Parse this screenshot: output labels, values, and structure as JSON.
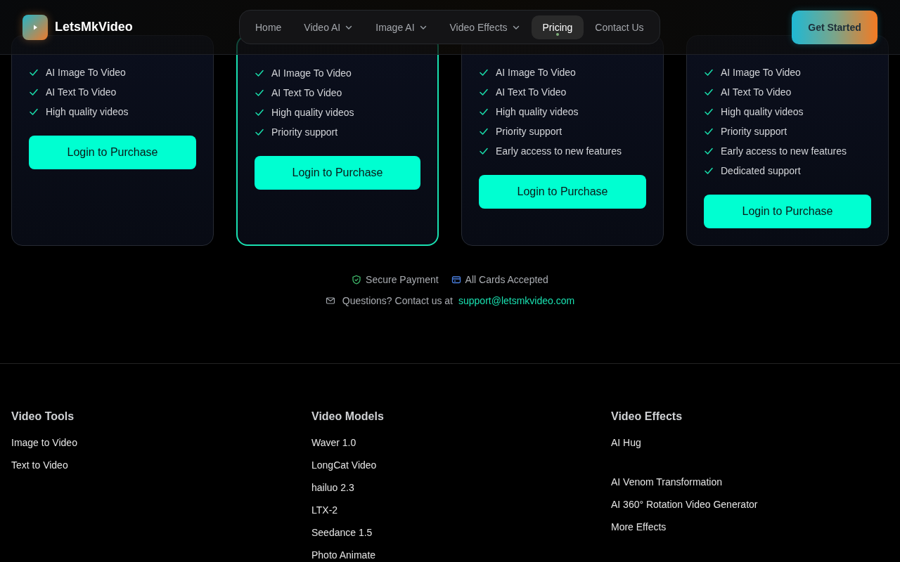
{
  "brand": {
    "name": "LetsMkVideo"
  },
  "nav": [
    {
      "label": "Home",
      "dropdown": false,
      "selected": false
    },
    {
      "label": "Video AI",
      "dropdown": true,
      "selected": false
    },
    {
      "label": "Image AI",
      "dropdown": true,
      "selected": false
    },
    {
      "label": "Video Effects",
      "dropdown": true,
      "selected": false
    },
    {
      "label": "Pricing",
      "dropdown": false,
      "selected": true
    },
    {
      "label": "Contact Us",
      "dropdown": false,
      "selected": false
    }
  ],
  "cta": "Get Started",
  "plans": [
    {
      "highlighted": false,
      "features": [
        "AI Image To Video",
        "AI Text To Video",
        "High quality videos"
      ],
      "button": "Login to Purchase"
    },
    {
      "highlighted": true,
      "features": [
        "AI Image To Video",
        "AI Text To Video",
        "High quality videos",
        "Priority support"
      ],
      "button": "Login to Purchase"
    },
    {
      "highlighted": false,
      "features": [
        "AI Image To Video",
        "AI Text To Video",
        "High quality videos",
        "Priority support",
        "Early access to new features"
      ],
      "button": "Login to Purchase"
    },
    {
      "highlighted": false,
      "features": [
        "AI Image To Video",
        "AI Text To Video",
        "High quality videos",
        "Priority support",
        "Early access to new features",
        "Dedicated support"
      ],
      "button": "Login to Purchase"
    }
  ],
  "trust": [
    {
      "kind": "shield",
      "label": "Secure Payment"
    },
    {
      "kind": "card",
      "label": "All Cards Accepted"
    }
  ],
  "contact": {
    "text": "Questions? Contact us at",
    "email": "support@letsmkvideo.com"
  },
  "footer": [
    {
      "title": "Video Tools",
      "links": [
        "Image to Video",
        "Text to Video"
      ]
    },
    {
      "title": "Video Models",
      "links": [
        "Waver 1.0",
        "LongCat Video",
        "hailuo 2.3",
        "LTX-2",
        "Seedance 1.5",
        "Photo Animate"
      ]
    },
    {
      "title": "Video Effects",
      "links": [
        "AI Hug",
        "AI Venom Transformation",
        "AI 360° Rotation Video Generator",
        "More Effects"
      ]
    }
  ]
}
